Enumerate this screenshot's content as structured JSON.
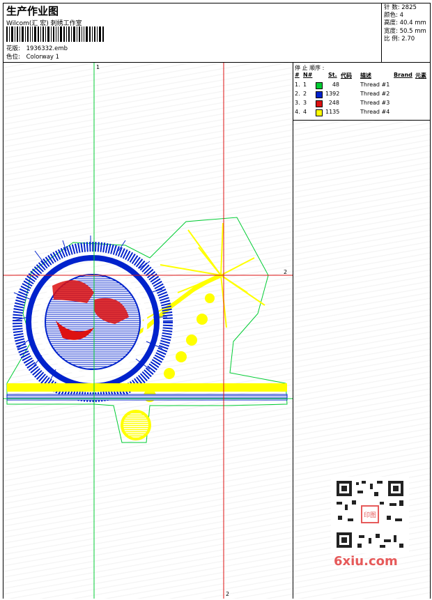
{
  "header": {
    "title": "生产作业图",
    "subtitle": "Wilcom(汇 宏) 刺绣工作室",
    "design_label": "花版:",
    "design_value": "1936332.emb",
    "colorway_label": "色位:",
    "colorway_value": "Colorway 1"
  },
  "stats": {
    "stitches": "针 数: 2825",
    "colors": "颜色: 4",
    "height": "高度: 40.4 mm",
    "width": "宽度: 50.5 mm",
    "scale": "比 例: 2.70"
  },
  "sequence": {
    "title": "停 止 顺序 :",
    "headers": [
      "#",
      "N#",
      "St.",
      "代码",
      "描述",
      "Brand",
      "元素"
    ],
    "rows": [
      {
        "idx": "1.",
        "n": "1",
        "st": "48",
        "color": "#00cc33",
        "desc": "Thread #1"
      },
      {
        "idx": "2.",
        "n": "2",
        "st": "1392",
        "color": "#0022cc",
        "desc": "Thread #2"
      },
      {
        "idx": "3.",
        "n": "3",
        "st": "248",
        "color": "#dd1111",
        "desc": "Thread #3"
      },
      {
        "idx": "4.",
        "n": "4",
        "st": "1135",
        "color": "#ffff00",
        "desc": "Thread #4"
      }
    ]
  },
  "axes": {
    "green_top": "1",
    "red_right": "2",
    "red_bottom": "2"
  },
  "watermark": {
    "text": "6xiu.com",
    "seal": "印图"
  },
  "colors": {
    "green": "#00cc33",
    "blue": "#0022cc",
    "red": "#dd1111",
    "yellow": "#ffff00"
  }
}
